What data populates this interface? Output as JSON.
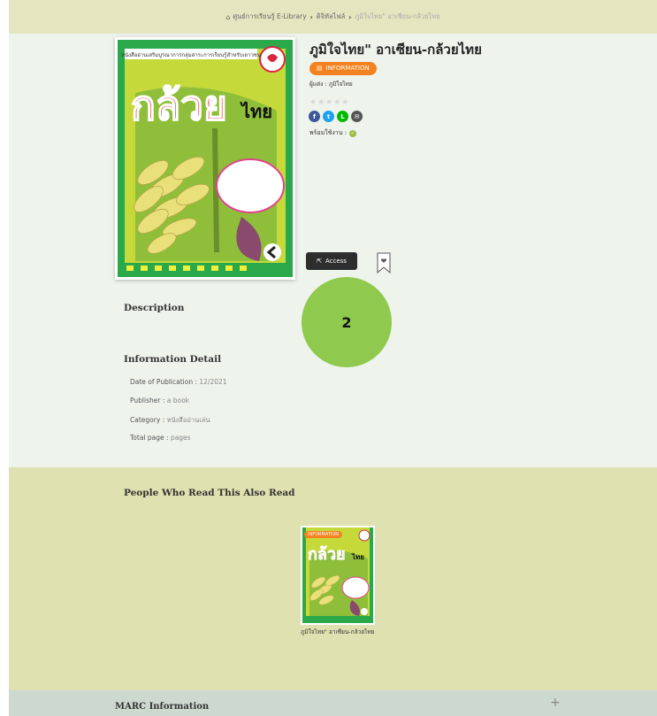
{
  "breadcrumb": {
    "items": [
      "ภูมิใจไทย",
      "ภูมิใจไทย",
      "ภูมิใจไทย"
    ],
    "home": "ศูนย์การเรียนรู้ E-Library",
    "category": "ดิจิทัลไฟล์",
    "current": "ภูมิใจไทย\" อาเซียน-กล้วยไทย"
  },
  "book": {
    "title": "ภูมิใจไทย\" อาเซียน-กล้วยไทย",
    "badge": "INFORMATION",
    "author": "ผู้แต่ง : ภูมิใจไทย",
    "stars": "★★★★★",
    "status_label": "พร้อมใช้งาน :",
    "cover_title": "กล้วย",
    "cover_title_small": "ไทย",
    "cover_top_text": "หนังสืออ่านเสริมบูรณาการกลุ่มสาระการเรียนรู้สำหรับเยาวชน",
    "cover_logo_text": "ภูมิใจไทย"
  },
  "shares": [
    {
      "name": "facebook",
      "glyph": "f",
      "color": "#3b5998"
    },
    {
      "name": "twitter",
      "glyph": "t",
      "color": "#1da1f2"
    },
    {
      "name": "line",
      "glyph": "L",
      "color": "#00b900"
    },
    {
      "name": "email",
      "glyph": "✉",
      "color": "#555555"
    }
  ],
  "actions": {
    "access_label": "Access"
  },
  "annotation": {
    "number": "2"
  },
  "sections": {
    "description": "Description",
    "information_detail": "Information Detail",
    "related": "People Who Read This Also Read",
    "marc": "MARC Information"
  },
  "details": {
    "date_label": "Date of Publication :",
    "date_value": "12/2021",
    "publisher_label": "Publisher :",
    "publisher_value": "a book",
    "category_label": "Category :",
    "category_value": "หนังสืออ่านเล่น",
    "total_label": "Total page :",
    "total_value": "pages"
  },
  "related": {
    "badge": "INFORMATION",
    "title": "ภูมิใจไทย\" อาเซียน-กล้วยไทย"
  },
  "colors": {
    "accent": "#f58220",
    "header_bg": "#e4e6c0",
    "page_bg": "#eef3ec",
    "related_bg": "#dfe1b0",
    "marc_bg": "#cdd8cf",
    "annotation_circle": "#8fca4e"
  }
}
